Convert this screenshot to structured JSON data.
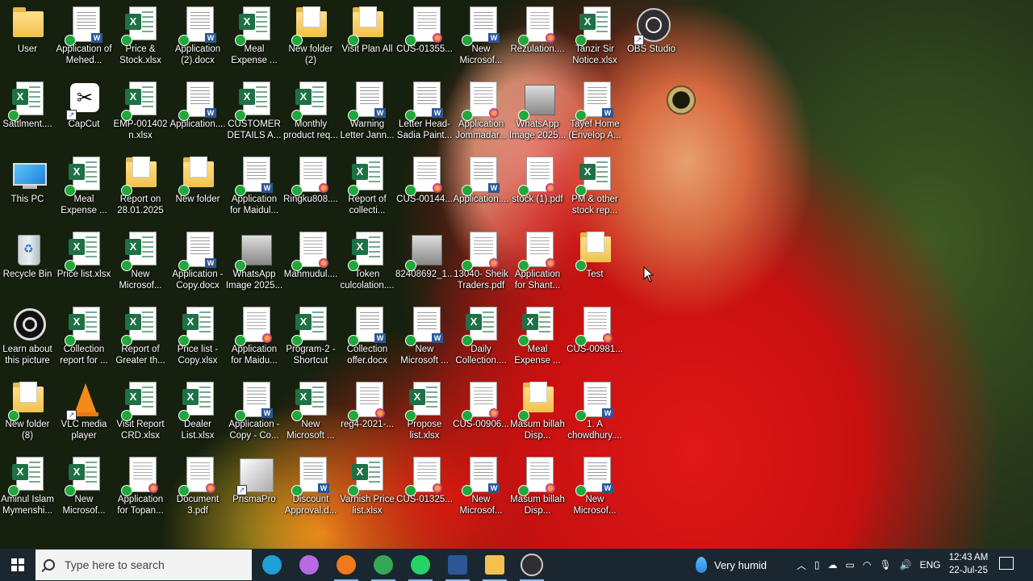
{
  "desktop": {
    "icons": [
      {
        "label": "User",
        "type": "userfolder",
        "col": 0,
        "row": 0
      },
      {
        "label": "Application of Mehed...",
        "type": "doc",
        "col": 1,
        "row": 0
      },
      {
        "label": "Price & Stock.xlsx",
        "type": "excel",
        "col": 2,
        "row": 0
      },
      {
        "label": "Application (2).docx",
        "type": "doc",
        "col": 3,
        "row": 0
      },
      {
        "label": "Meal Expense ...",
        "type": "excel",
        "col": 4,
        "row": 0
      },
      {
        "label": "New folder (2)",
        "type": "folder",
        "col": 5,
        "row": 0
      },
      {
        "label": "Visit Plan All",
        "type": "folder",
        "col": 6,
        "row": 0
      },
      {
        "label": "CUS-01355...",
        "type": "pdf",
        "col": 7,
        "row": 0
      },
      {
        "label": "New Microsof...",
        "type": "doc",
        "col": 8,
        "row": 0
      },
      {
        "label": "Rezulation....",
        "type": "pdf",
        "col": 9,
        "row": 0
      },
      {
        "label": "Tanzir Sir Notice.xlsx",
        "type": "excel",
        "col": 10,
        "row": 0
      },
      {
        "label": "OBS Studio",
        "type": "obs",
        "col": 11,
        "row": 0
      },
      {
        "label": "Sattlment....",
        "type": "excel",
        "col": 0,
        "row": 1
      },
      {
        "label": "CapCut",
        "type": "capcut",
        "col": 1,
        "row": 1
      },
      {
        "label": "EMP-001402 n.xlsx",
        "type": "excel",
        "col": 2,
        "row": 1
      },
      {
        "label": "Application....",
        "type": "doc",
        "col": 3,
        "row": 1
      },
      {
        "label": "CUSTOMER DETAILS A...",
        "type": "excel",
        "col": 4,
        "row": 1
      },
      {
        "label": "Monthly product req...",
        "type": "excel",
        "col": 5,
        "row": 1
      },
      {
        "label": "Warning Letter Jann...",
        "type": "doc",
        "col": 6,
        "row": 1
      },
      {
        "label": "Letter Head- Sadia Paint...",
        "type": "doc",
        "col": 7,
        "row": 1
      },
      {
        "label": "Application Jommadar...",
        "type": "pdf",
        "col": 8,
        "row": 1
      },
      {
        "label": "WhatsApp Image 2025...",
        "type": "image",
        "col": 9,
        "row": 1
      },
      {
        "label": "Tayef Home (Envelop A...",
        "type": "doc",
        "col": 10,
        "row": 1
      },
      {
        "label": "This PC",
        "type": "pc",
        "col": 0,
        "row": 2
      },
      {
        "label": "Meal Expense ...",
        "type": "excel",
        "col": 1,
        "row": 2
      },
      {
        "label": "Report on 28.01.2025",
        "type": "folder",
        "col": 2,
        "row": 2
      },
      {
        "label": "New folder",
        "type": "folder",
        "col": 3,
        "row": 2
      },
      {
        "label": "Application for Maidul...",
        "type": "doc",
        "col": 4,
        "row": 2
      },
      {
        "label": "Ringku808....",
        "type": "pdf",
        "col": 5,
        "row": 2
      },
      {
        "label": "Report of collecti...",
        "type": "excel",
        "col": 6,
        "row": 2
      },
      {
        "label": "CUS-00144...",
        "type": "pdf",
        "col": 7,
        "row": 2
      },
      {
        "label": "Application....",
        "type": "doc",
        "col": 8,
        "row": 2
      },
      {
        "label": "stock (1).pdf",
        "type": "pdf",
        "col": 9,
        "row": 2
      },
      {
        "label": "PM & other stock rep...",
        "type": "excel",
        "col": 10,
        "row": 2
      },
      {
        "label": "Recycle Bin",
        "type": "bin",
        "col": 0,
        "row": 3
      },
      {
        "label": "Price list.xlsx",
        "type": "excel",
        "col": 1,
        "row": 3
      },
      {
        "label": "New Microsof...",
        "type": "excel",
        "col": 2,
        "row": 3
      },
      {
        "label": "Application - Copy.docx",
        "type": "doc",
        "col": 3,
        "row": 3
      },
      {
        "label": "WhatsApp Image 2025...",
        "type": "image",
        "col": 4,
        "row": 3
      },
      {
        "label": "Mahmudul....",
        "type": "pdf",
        "col": 5,
        "row": 3
      },
      {
        "label": "Token culcolation....",
        "type": "excel",
        "col": 6,
        "row": 3
      },
      {
        "label": "82408692_1...",
        "type": "image",
        "col": 7,
        "row": 3
      },
      {
        "label": "13040- Sheik Traders.pdf",
        "type": "pdf",
        "col": 8,
        "row": 3
      },
      {
        "label": "Application for Shant...",
        "type": "pdf",
        "col": 9,
        "row": 3
      },
      {
        "label": "Test",
        "type": "folder",
        "col": 10,
        "row": 3
      },
      {
        "label": "Learn about this picture",
        "type": "learn",
        "col": 0,
        "row": 4
      },
      {
        "label": "Collection report for ...",
        "type": "excel",
        "col": 1,
        "row": 4
      },
      {
        "label": "Report of Greater th...",
        "type": "excel",
        "col": 2,
        "row": 4
      },
      {
        "label": "Price list - Copy.xlsx",
        "type": "excel",
        "col": 3,
        "row": 4
      },
      {
        "label": "Application for Maidu...",
        "type": "pdf",
        "col": 4,
        "row": 4
      },
      {
        "label": "Program-2 - Shortcut",
        "type": "excel",
        "col": 5,
        "row": 4
      },
      {
        "label": "Collection offer.docx",
        "type": "doc",
        "col": 6,
        "row": 4
      },
      {
        "label": "New Microsoft ...",
        "type": "doc",
        "col": 7,
        "row": 4
      },
      {
        "label": "Daily Collection....",
        "type": "excel",
        "col": 8,
        "row": 4
      },
      {
        "label": "Meal Expense ...",
        "type": "excel",
        "col": 9,
        "row": 4
      },
      {
        "label": "CUS-00981...",
        "type": "pdf",
        "col": 10,
        "row": 4
      },
      {
        "label": "New folder (8)",
        "type": "folder",
        "col": 0,
        "row": 5
      },
      {
        "label": "VLC media player",
        "type": "vlc",
        "col": 1,
        "row": 5
      },
      {
        "label": "Visit Report CRD.xlsx",
        "type": "excel",
        "col": 2,
        "row": 5
      },
      {
        "label": "Dealer List.xlsx",
        "type": "excel",
        "col": 3,
        "row": 5
      },
      {
        "label": "Application - Copy - Co...",
        "type": "doc",
        "col": 4,
        "row": 5
      },
      {
        "label": "New Microsoft ...",
        "type": "excel",
        "col": 5,
        "row": 5
      },
      {
        "label": "reg4-2021-...",
        "type": "pdf",
        "col": 6,
        "row": 5
      },
      {
        "label": "Propose list.xlsx",
        "type": "excel",
        "col": 7,
        "row": 5
      },
      {
        "label": "CUS-00906...",
        "type": "pdf",
        "col": 8,
        "row": 5
      },
      {
        "label": "Masum billah Disp...",
        "type": "folder",
        "col": 9,
        "row": 5
      },
      {
        "label": "1. A chowdhury....",
        "type": "doc",
        "col": 10,
        "row": 5
      },
      {
        "label": "Aminul Islam Mymenshi...",
        "type": "excel",
        "col": 0,
        "row": 6
      },
      {
        "label": "New Microsof...",
        "type": "excel",
        "col": 1,
        "row": 6
      },
      {
        "label": "Application for Topan...",
        "type": "pdf",
        "col": 2,
        "row": 6
      },
      {
        "label": "Document 3.pdf",
        "type": "pdf",
        "col": 3,
        "row": 6
      },
      {
        "label": "PrismaPro",
        "type": "prisma",
        "col": 4,
        "row": 6
      },
      {
        "label": "Discount Approval.d...",
        "type": "doc",
        "col": 5,
        "row": 6
      },
      {
        "label": "Varnish Price list.xlsx",
        "type": "excel",
        "col": 6,
        "row": 6
      },
      {
        "label": "CUS-01325...",
        "type": "pdf",
        "col": 7,
        "row": 6
      },
      {
        "label": "New Microsof...",
        "type": "doc",
        "col": 8,
        "row": 6
      },
      {
        "label": "Masum billah Disp...",
        "type": "pdf",
        "col": 9,
        "row": 6
      },
      {
        "label": "New Microsof...",
        "type": "doc",
        "col": 10,
        "row": 6
      }
    ]
  },
  "taskbar": {
    "search_placeholder": "Type here to search",
    "apps": [
      {
        "name": "edge",
        "color": "#1fa0d8"
      },
      {
        "name": "copilot",
        "color": "#b86ae0"
      },
      {
        "name": "firefox",
        "color": "#f07a1a"
      },
      {
        "name": "chrome",
        "color": "#34a853"
      },
      {
        "name": "whatsapp",
        "color": "#25d366"
      },
      {
        "name": "word",
        "color": "#2b5797"
      },
      {
        "name": "file-explorer",
        "color": "#f2c14e"
      },
      {
        "name": "obs",
        "color": "#302e31"
      }
    ],
    "weather": "Very humid",
    "language": "ENG",
    "time": "12:43 AM",
    "date": "22-Jul-25"
  }
}
